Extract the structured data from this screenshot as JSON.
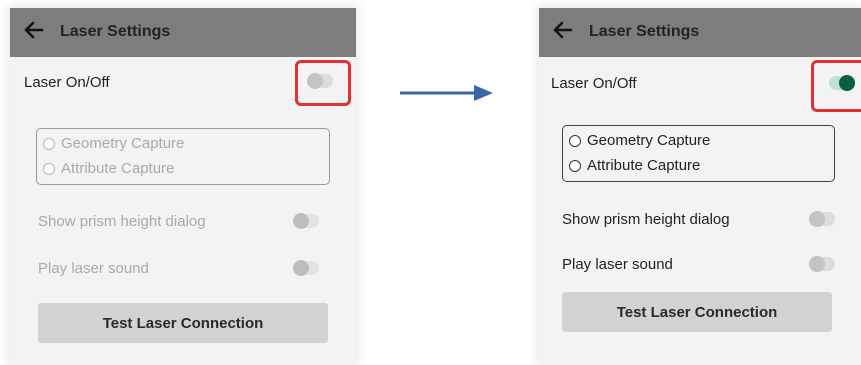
{
  "left_panel": {
    "title": "Laser Settings",
    "laser_toggle_label": "Laser On/Off",
    "laser_toggle_state": "off",
    "radio_options": [
      "Geometry Capture",
      "Attribute Capture"
    ],
    "prism_label": "Show prism height dialog",
    "sound_label": "Play laser sound",
    "test_button_label": "Test Laser Connection"
  },
  "right_panel": {
    "title": "Laser Settings",
    "laser_toggle_label": "Laser On/Off",
    "laser_toggle_state": "on",
    "radio_options": [
      "Geometry Capture",
      "Attribute Capture"
    ],
    "prism_label": "Show prism height dialog",
    "sound_label": "Play laser sound",
    "test_button_label": "Test Laser Connection"
  },
  "colors": {
    "header": "#7d7d7d",
    "highlight": "#e03030",
    "toggle_on": "#0b5e3f",
    "arrow": "#3a66a8"
  },
  "icons": {
    "back": "back-arrow-icon",
    "transition": "right-arrow-icon"
  }
}
